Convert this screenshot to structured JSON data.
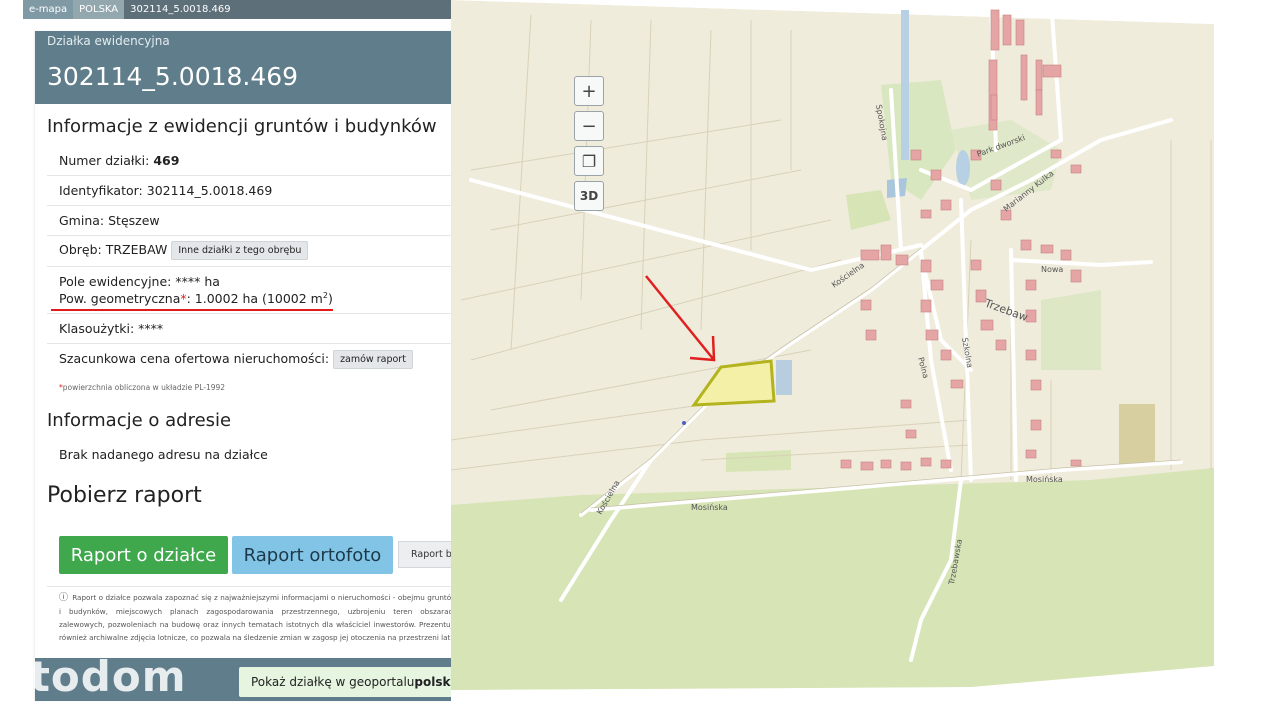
{
  "breadcrumb": {
    "items": [
      "e-mapa",
      "POLSKA",
      "302114_5.0018.469"
    ]
  },
  "panel": {
    "subtitle": "Działka ewidencyjna",
    "title": "302114_5.0018.469",
    "section1_title": "Informacje z ewidencji gruntów i budynków",
    "numer_label": "Numer działki: ",
    "numer_value": "469",
    "identyfikator": "Identyfikator: 302114_5.0018.469",
    "gmina": "Gmina: Stęszew",
    "obreb": "Obręb: TRZEBAW",
    "obreb_button": "Inne działki z tego obrębu",
    "pole_ewid": "Pole ewidencyjne: **** ha",
    "pow_geom_label": "Pow. geometryczna",
    "pow_geom_asterisk": "*",
    "pow_geom_value": ": 1.0002 ha (10002 m",
    "pow_geom_sup": "2",
    "pow_geom_end": ")",
    "klasouzytki": "Klasoużytki: ****",
    "cena_label": "Szacunkowa cena ofertowa nieruchomości:",
    "cena_button": "zamów raport",
    "footnote_ast": "*",
    "footnote": "powierzchnia obliczona w układzie PL-1992",
    "section2_title": "Informacje o adresie",
    "adres": "Brak nadanego adresu na działce",
    "section3_title": "Pobierz raport",
    "btn_raport_dzialce": "Raport o działce",
    "btn_raport_ortofoto": "Raport ortofoto",
    "btn_raport_be": "Raport be",
    "info_icon": "ⓘ",
    "info_text": "Raport o działce pozwala zapoznać się z najważniejszymi informacjami o nieruchomości - obejmu gruntów i budynków, miejscowych planach zagospodarowania przestrzennego, uzbrojeniu teren obszarach zalewowych, pozwoleniach na budowę oraz innych tematach istotnych dla właściciel inwestorów. Prezentuje również archiwalne zdjęcia lotnicze, co pozwala na śledzenie zmian w zagosp jej otoczenia na przestrzeni lat.",
    "show_prefix": "Pokaż działkę w geoportalu ",
    "show_bold": "polska",
    "watermark": "otodom"
  },
  "map": {
    "controls": [
      "+",
      "−",
      "❐",
      "3D"
    ],
    "labels": {
      "spokojna": "Spokojna",
      "park": "Park dworski",
      "marianny": "Marianny Kulka",
      "koscielna1": "Kościelna",
      "koscielna2": "Kościelna",
      "nowa": "Nowa",
      "trzebaw": "Trzebaw",
      "polna": "Polna",
      "szkolna": "Szkolna",
      "mosinska1": "Mosińska",
      "mosinska2": "Mosińska",
      "trzebawska": "Trzebawska"
    },
    "colors": {
      "base": "#f0ecdc",
      "forest": "#d6e4b6",
      "road": "#ffffff",
      "parcel_fill": "#f5f0a8",
      "parcel_stroke": "#b3b31d",
      "arrow": "#e02020",
      "building": "#e6a5a5"
    }
  }
}
